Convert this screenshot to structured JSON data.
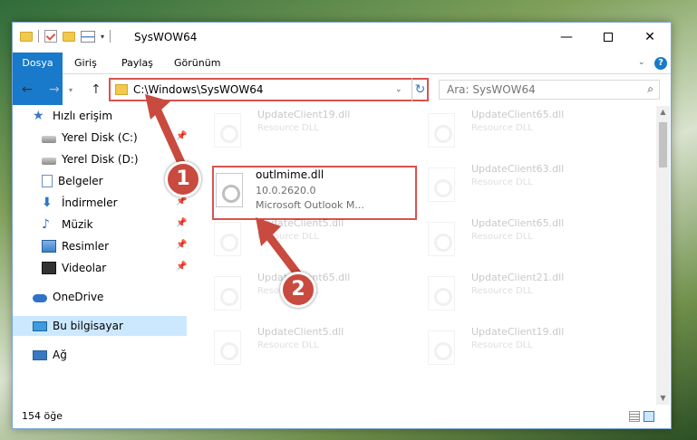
{
  "window": {
    "title": "SysWOW64",
    "controls": {
      "minimize": "—",
      "maximize": "",
      "close": "✕"
    }
  },
  "ribbon": {
    "file_tab": "Dosya",
    "tabs": [
      "Giriş",
      "Paylaş",
      "Görünüm"
    ],
    "help": "?"
  },
  "nav": {
    "back": "←",
    "forward": "→",
    "up": "↑",
    "address": "C:\\Windows\\SysWOW64",
    "search_placeholder": "Ara: SysWOW64"
  },
  "sidebar": {
    "items": [
      {
        "label": "Hızlı erişim",
        "icon": "star-icon"
      },
      {
        "label": "Yerel Disk (C:)",
        "icon": "disk-icon",
        "pinned": true
      },
      {
        "label": "Yerel Disk (D:)",
        "icon": "disk-icon"
      },
      {
        "label": "Belgeler",
        "icon": "document-icon",
        "pinned": true
      },
      {
        "label": "İndirmeler",
        "icon": "download-icon",
        "pinned": true
      },
      {
        "label": "Müzik",
        "icon": "music-icon",
        "pinned": true
      },
      {
        "label": "Resimler",
        "icon": "pictures-icon",
        "pinned": true
      },
      {
        "label": "Videolar",
        "icon": "video-icon",
        "pinned": true
      },
      {
        "label": "OneDrive",
        "icon": "cloud-icon"
      },
      {
        "label": "Bu bilgisayar",
        "icon": "computer-icon",
        "selected": true
      },
      {
        "label": "Ağ",
        "icon": "network-icon"
      }
    ]
  },
  "files": {
    "col1": [
      {
        "name": "UpdateClient19.dll",
        "desc": "Resource DLL"
      },
      {
        "name": "outlmime.dll",
        "version": "10.0.2620.0",
        "desc": "Microsoft Outlook M..."
      },
      {
        "name": "UpdateClient5.dll",
        "desc": "Resource DLL"
      },
      {
        "name": "UpdateClient65.dll",
        "desc": "Resource DLL"
      },
      {
        "name": "UpdateClient5.dll",
        "desc": "Resource DLL"
      }
    ],
    "col2": [
      {
        "name": "UpdateClient65.dll",
        "desc": "Resource DLL"
      },
      {
        "name": "UpdateClient63.dll",
        "desc": "Resource DLL"
      },
      {
        "name": "UpdateClient65.dll",
        "desc": "Resource DLL"
      },
      {
        "name": "UpdateClient21.dll",
        "desc": "Resource DLL"
      },
      {
        "name": "UpdateClient19.dll",
        "desc": "Resource DLL"
      }
    ]
  },
  "status": {
    "count": "154 öğe"
  },
  "annotations": {
    "step1": "1",
    "step2": "2"
  },
  "colors": {
    "accent": "#1979ca",
    "highlight": "#d9534f",
    "selection": "#cce8ff"
  }
}
